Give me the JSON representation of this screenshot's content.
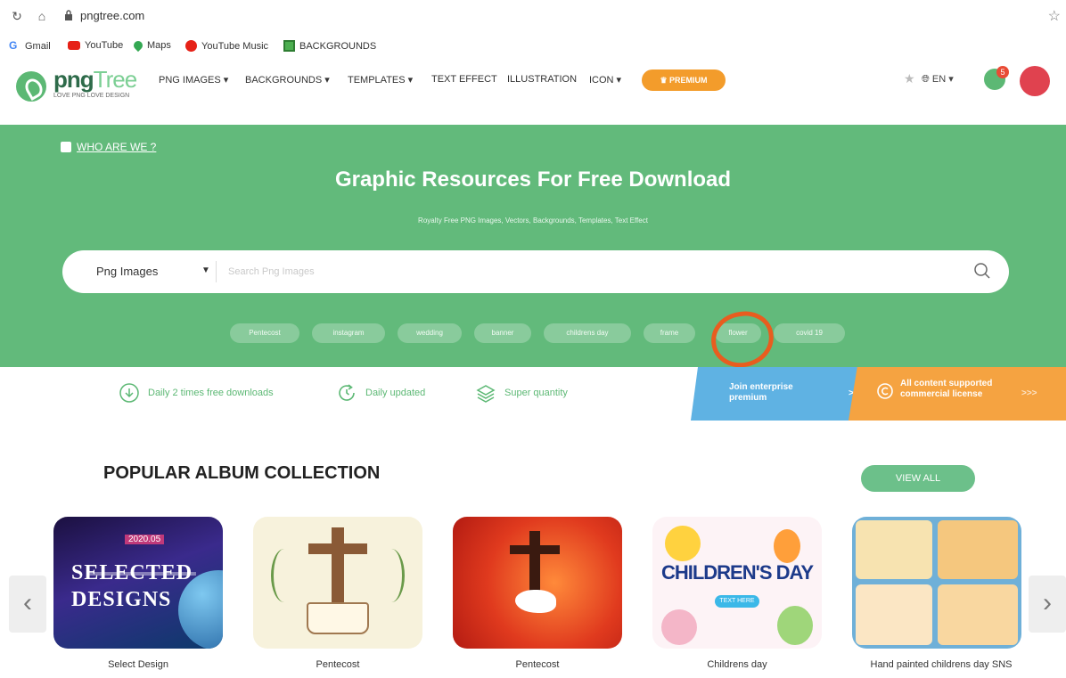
{
  "browser": {
    "url": "pngtree.com",
    "bookmarks": [
      {
        "label": "Gmail",
        "icon": "google-icon"
      },
      {
        "label": "YouTube",
        "icon": "youtube-icon"
      },
      {
        "label": "Maps",
        "icon": "maps-pin-icon"
      },
      {
        "label": "YouTube Music",
        "icon": "youtube-music-icon"
      },
      {
        "label": "BACKGROUNDS",
        "icon": "bookmark-page-icon"
      }
    ]
  },
  "header": {
    "logo_main": "png",
    "logo_tree": "Tree",
    "logo_tagline": "LOVE PNG LOVE DESIGN",
    "menu": [
      "PNG IMAGES ▾",
      "BACKGROUNDS ▾",
      "TEMPLATES ▾",
      "TEXT EFFECT",
      "ILLUSTRATION",
      "ICON ▾"
    ],
    "premium_label": "♛ PREMIUM",
    "lang": "EN ▾",
    "notif_count": "5",
    "colors": {
      "brand_green": "#62ba7b",
      "premium_orange": "#f39c2b",
      "avatar_red": "#e0424f"
    }
  },
  "hero": {
    "who_link": "WHO ARE WE ?",
    "title": "Graphic Resources For Free Download",
    "subtitle": "Royalty Free PNG Images, Vectors, Backgrounds, Templates, Text Effect",
    "search": {
      "category": "Png Images",
      "placeholder": "Search Png Images"
    },
    "tags": [
      "Pentecost",
      "instagram",
      "wedding",
      "banner",
      "childrens day",
      "frame",
      "flower",
      "covid 19"
    ],
    "annotation": "orange-circle-around-flower-tag"
  },
  "features": [
    {
      "label": "Daily 2 times free downloads",
      "icon": "download-icon"
    },
    {
      "label": "Daily updated",
      "icon": "refresh-icon"
    },
    {
      "label": "Super quantity",
      "icon": "layers-icon"
    }
  ],
  "promos": {
    "enterprise": "Join enterprise premium",
    "enterprise_arrow": ">",
    "commercial": "All content supported commercial license",
    "commercial_arrow": ">>>"
  },
  "albums": {
    "title": "POPULAR ALBUM COLLECTION",
    "view_all": "VIEW ALL",
    "items": [
      {
        "label": "Select Design",
        "art_top": "2020.05",
        "art_main": "SELECTED DESIGNS"
      },
      {
        "label": "Pentecost"
      },
      {
        "label": "Pentecost"
      },
      {
        "label": "Childrens day",
        "art_main": "CHILDREN'S DAY",
        "art_sub": "TEXT HERE"
      },
      {
        "label": "Hand painted childrens day SNS"
      }
    ]
  }
}
